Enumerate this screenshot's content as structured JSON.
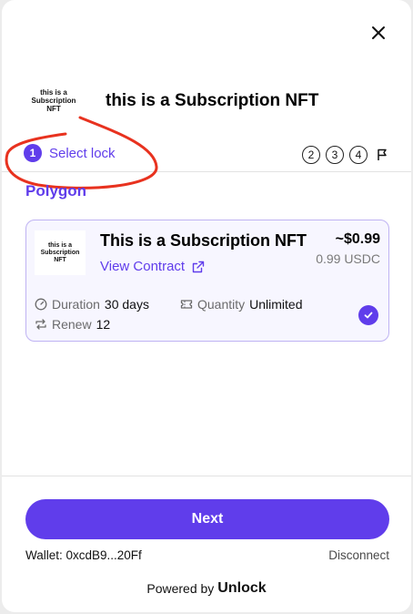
{
  "header": {
    "logo_text": "this is a\nSubscription\nNFT",
    "title": "this is a Subscription NFT",
    "close_icon": "close-icon"
  },
  "steps": {
    "active": {
      "number": "1",
      "label": "Select lock"
    },
    "upcoming": [
      "2",
      "3",
      "4"
    ],
    "final_icon": "flag-icon"
  },
  "network": "Polygon",
  "lock": {
    "logo_text": "this is a\nSubscription\nNFT",
    "name": "This is a Subscription NFT",
    "view_contract": "View Contract",
    "price": "~$0.99",
    "price_token": "0.99 USDC",
    "duration_label": "Duration",
    "duration_value": "30 days",
    "quantity_label": "Quantity",
    "quantity_value": "Unlimited",
    "renew_label": "Renew",
    "renew_value": "12",
    "selected": true
  },
  "footer": {
    "next_label": "Next",
    "wallet": "Wallet: 0xcdB9...20Ff",
    "disconnect": "Disconnect",
    "powered_by": "Powered by",
    "brand": "Unlock"
  },
  "colors": {
    "accent": "#603deb",
    "annotation": "#e8321f"
  }
}
